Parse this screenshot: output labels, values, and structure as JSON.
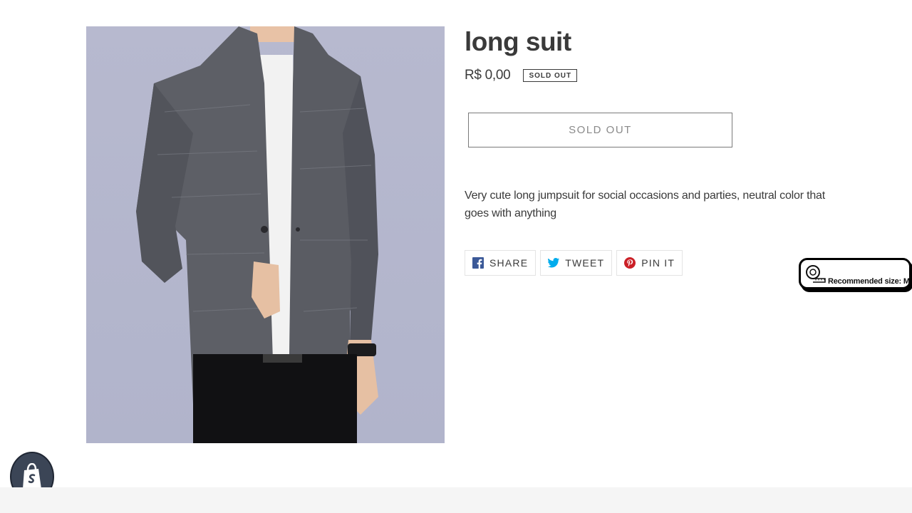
{
  "product": {
    "title": "long suit",
    "price": "R$ 0,00",
    "badge": "SOLD OUT",
    "button_label": "SOLD OUT",
    "description": "Very cute long jumpsuit for social occasions and parties, neutral color that goes with anything",
    "image_icon": "product-photo-jacket"
  },
  "share": [
    {
      "label": "SHARE",
      "icon": "facebook-icon",
      "color": "#3b5998"
    },
    {
      "label": "TWEET",
      "icon": "twitter-icon",
      "color": "#00aced"
    },
    {
      "label": "PIN IT",
      "icon": "pinterest-icon",
      "color": "#cb2027"
    }
  ],
  "size_widget": {
    "text": "Recommended size: M",
    "icon": "tape-measure-icon"
  },
  "shop_badge": {
    "icon": "shopify-bag-icon"
  }
}
